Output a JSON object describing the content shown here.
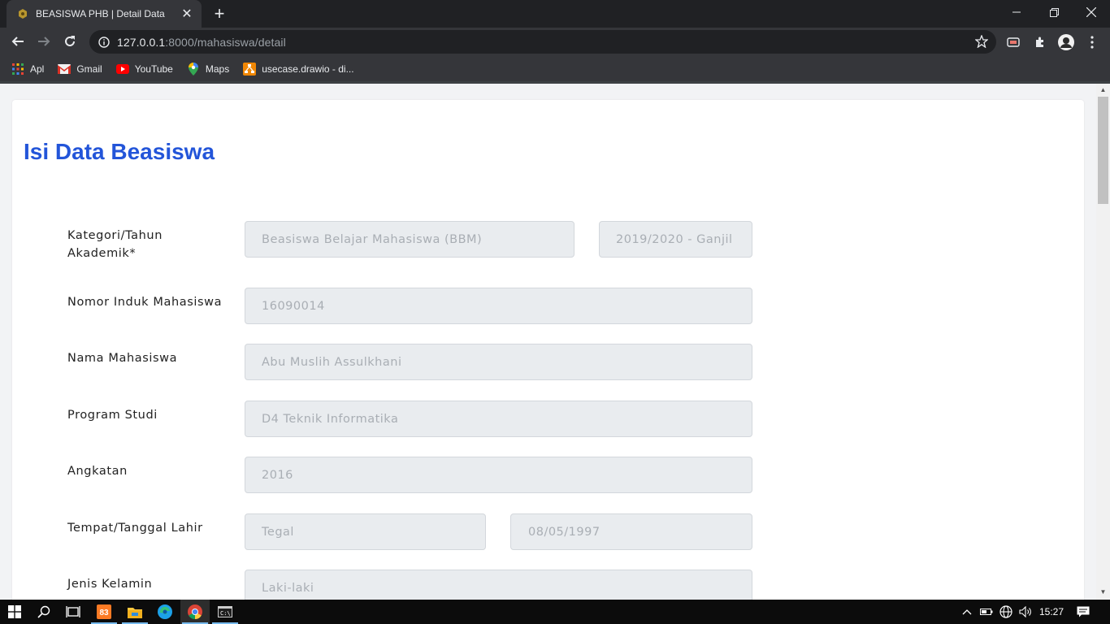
{
  "browser": {
    "tab_title": "BEASISWA PHB | Detail Data",
    "url_host": "127.0.0.1",
    "url_rest": ":8000/mahasiswa/detail",
    "bookmarks": [
      {
        "label": "Apl",
        "icon": "apps-grid-icon"
      },
      {
        "label": "Gmail",
        "icon": "gmail-icon"
      },
      {
        "label": "YouTube",
        "icon": "youtube-icon"
      },
      {
        "label": "Maps",
        "icon": "maps-pin-icon"
      },
      {
        "label": "usecase.drawio - di...",
        "icon": "drawio-icon"
      }
    ]
  },
  "page": {
    "title": "Isi Data Beasiswa",
    "fields": {
      "kategori_label": "Kategori/Tahun Akademik*",
      "kategori_value": "Beasiswa Belajar Mahasiswa (BBM)",
      "tahun_value": "2019/2020 - Ganjil",
      "nim_label": "Nomor Induk Mahasiswa",
      "nim_value": "16090014",
      "nama_label": "Nama Mahasiswa",
      "nama_value": "Abu Muslih Assulkhani",
      "prodi_label": "Program Studi",
      "prodi_value": "D4 Teknik Informatika",
      "angkatan_label": "Angkatan",
      "angkatan_value": "2016",
      "ttl_label": "Tempat/Tanggal Lahir",
      "tempat_value": "Tegal",
      "tanggal_value": "08/05/1997",
      "jk_label": "Jenis Kelamin",
      "jk_value": "Laki-laki"
    }
  },
  "taskbar": {
    "clock": "15:27"
  },
  "colors": {
    "title_blue": "#2355d9",
    "field_bg": "#e9ecef",
    "chrome_dark": "#202124",
    "chrome_toolbar": "#35363a"
  }
}
